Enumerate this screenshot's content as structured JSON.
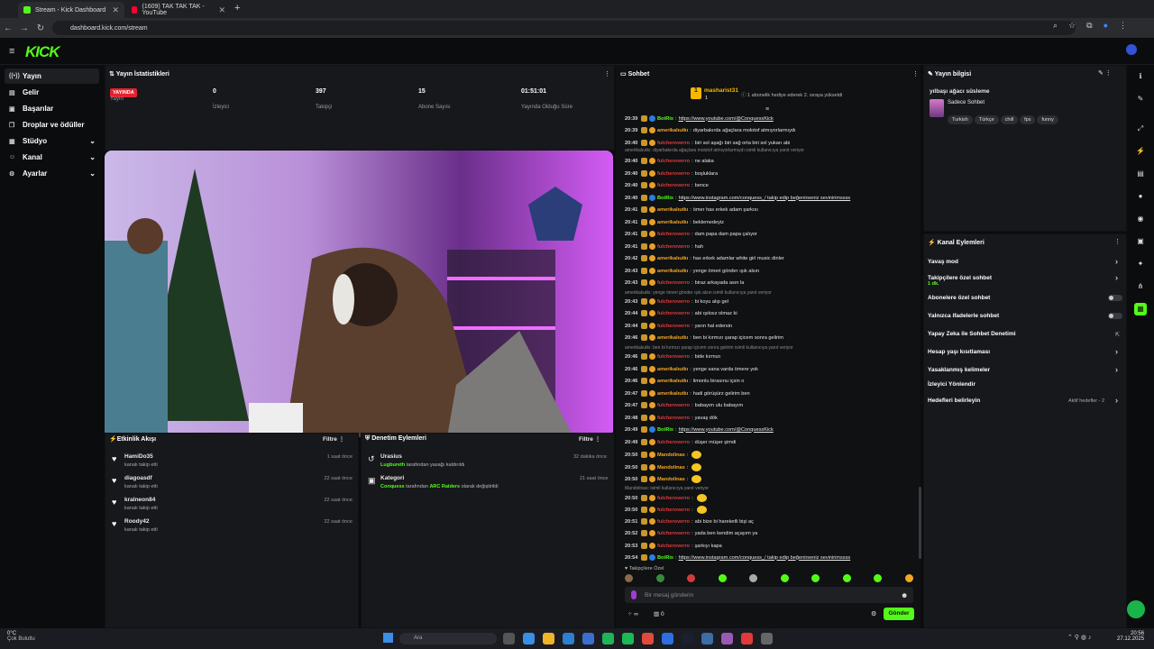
{
  "browser": {
    "tabs": [
      {
        "label": "Stream - Kick Dashboard"
      },
      {
        "label": "(1609) TAK TAK TAK - YouTube"
      }
    ],
    "url": "dashboard.kick.com/stream"
  },
  "nav": {
    "items": [
      {
        "label": "Yayın",
        "icon": "broadcast-icon"
      },
      {
        "label": "Gelir",
        "icon": "revenue-icon"
      },
      {
        "label": "Başarılar",
        "icon": "achievements-icon"
      },
      {
        "label": "Droplar ve ödüller",
        "icon": "drops-icon"
      },
      {
        "label": "Stüdyo",
        "icon": "studio-icon"
      },
      {
        "label": "Kanal",
        "icon": "channel-icon"
      },
      {
        "label": "Ayarlar",
        "icon": "settings-icon"
      }
    ]
  },
  "stats": {
    "title": "Yayın İstatistikleri",
    "live": "YAYINDA",
    "items": [
      {
        "value": "",
        "label": "Yayın"
      },
      {
        "value": "0",
        "label": "İzleyici"
      },
      {
        "value": "397",
        "label": "Takipçi"
      },
      {
        "value": "15",
        "label": "Abone Sayısı"
      },
      {
        "value": "01:51:01",
        "label": "Yayında Olduğu Süre"
      }
    ]
  },
  "activity": {
    "title": "Etkinlik Akışı",
    "filter": "Filtre",
    "items": [
      {
        "name": "HamiDo35",
        "desc": "kanalı takip etti",
        "time": "1 saat önce"
      },
      {
        "name": "diagoasdf",
        "desc": "kanalı takip etti",
        "time": "22 saat önce"
      },
      {
        "name": "kralneon84",
        "desc": "kanalı takip etti",
        "time": "22 saat önce"
      },
      {
        "name": "Roody42",
        "desc": "kanalı takip etti",
        "time": "22 saat önce"
      }
    ]
  },
  "moderation": {
    "title": "Denetim Eylemleri",
    "filter": "Filtre",
    "items": [
      {
        "name": "Urasius",
        "actor": "Lugbureth",
        "desc": "tarafından yasağı kaldırıldı",
        "time": "32 dakika önce"
      },
      {
        "name": "Kategori",
        "actor": "Conquess",
        "mid": "tarafından",
        "target": "ARC Raiders",
        "desc": "olarak değiştirildi",
        "time": "21 saat önce"
      }
    ]
  },
  "chat": {
    "title": "Sohbet",
    "gifter": "masharist31",
    "gifter_count": "1",
    "gift_note": "1 abonelik hediye ederek 2. sıraya yükseldi",
    "messages": [
      {
        "t": "20:39",
        "u": "BotRix",
        "c": "#53fc18",
        "x": "https://www.youtube.com/@ConquessKick"
      },
      {
        "t": "20:39",
        "u": "amerikalıutkı",
        "c": "#f5a623",
        "x": "diyarbakırda ağaçlara molotof atmıyorlarmıydı"
      },
      {
        "t": "20:40",
        "u": "fulcheroverro",
        "c": "#e23b3b",
        "x": "biri sol aşağı biri sağ orta biri sol yukarı abi"
      },
      {
        "t": "20:40",
        "u": "fulcheroverro",
        "c": "#e23b3b",
        "x": "ne alaka"
      },
      {
        "t": "20:40",
        "u": "fulcheroverro",
        "c": "#e23b3b",
        "x": "boşluklara"
      },
      {
        "t": "20:40",
        "u": "fulcheroverro",
        "c": "#e23b3b",
        "x": "bence"
      },
      {
        "t": "20:40",
        "u": "BotRix",
        "c": "#53fc18",
        "x": "https://www.instagram.com/conquess_/ takip edip beğenirseniz sevinirimssss"
      },
      {
        "t": "20:41",
        "u": "amerikalıutkı",
        "c": "#f5a623",
        "x": "ömer has erkek adam şarkısı"
      },
      {
        "t": "20:41",
        "u": "amerikalıutkı",
        "c": "#f5a623",
        "x": "beklemedeyiz"
      },
      {
        "t": "20:41",
        "u": "fulcheroverro",
        "c": "#e23b3b",
        "x": "dam papa dam papa çalıyor"
      },
      {
        "t": "20:41",
        "u": "fulcheroverro",
        "c": "#e23b3b",
        "x": "hah"
      },
      {
        "t": "20:42",
        "u": "amerikalıutkı",
        "c": "#f5a623",
        "x": "has erkek adamlar white girl music dinler"
      },
      {
        "t": "20:43",
        "u": "amerikalıutkı",
        "c": "#f5a623",
        "x": "yenge ömeri gönder ışık alsın"
      },
      {
        "t": "20:43",
        "u": "fulcheroverro",
        "c": "#e23b3b",
        "x": "biraz arkayada asın la"
      },
      {
        "t": "20:43",
        "u": "fulcheroverro",
        "c": "#e23b3b",
        "x": "bi koyu alıp gel"
      },
      {
        "t": "20:44",
        "u": "fulcheroverro",
        "c": "#e23b3b",
        "x": "abi ışıksız olmaz ki"
      },
      {
        "t": "20:44",
        "u": "fulcheroverro",
        "c": "#e23b3b",
        "x": "yarın hal edersin"
      },
      {
        "t": "20:46",
        "u": "amerikalıutkı",
        "c": "#f5a623",
        "x": "ben bi kırmızı şarap içicem sonra gelirim"
      },
      {
        "t": "20:46",
        "u": "fulcheroverro",
        "c": "#e23b3b",
        "x": "bide kırmızı"
      },
      {
        "t": "20:46",
        "u": "amerikalıutkı",
        "c": "#f5a623",
        "x": "yenge sana varda ömere yok"
      },
      {
        "t": "20:46",
        "u": "amerikalıutkı",
        "c": "#f5a623",
        "x": "limonlu birasınu içsin o"
      },
      {
        "t": "20:47",
        "u": "amerikalıutkı",
        "c": "#f5a623",
        "x": "hadi görüşürz gelirim ben"
      },
      {
        "t": "20:47",
        "u": "fulcheroverro",
        "c": "#e23b3b",
        "x": "babayım ulu babayım"
      },
      {
        "t": "20:48",
        "u": "fulcheroverro",
        "c": "#e23b3b",
        "x": "yavaş dök"
      },
      {
        "t": "20:49",
        "u": "BotRix",
        "c": "#53fc18",
        "x": "https://www.youtube.com/@ConquessKick"
      },
      {
        "t": "20:49",
        "u": "fulcheroverro",
        "c": "#e23b3b",
        "x": "düşer müşer şimdi"
      },
      {
        "t": "20:50",
        "u": "Mandolinas",
        "c": "#f5a623",
        "x": ""
      },
      {
        "t": "20:50",
        "u": "Mandolinas",
        "c": "#f5a623",
        "x": ""
      },
      {
        "t": "20:50",
        "u": "Mandolinas",
        "c": "#f5a623",
        "x": ""
      },
      {
        "t": "20:50",
        "u": "fulcheroverro",
        "c": "#e23b3b",
        "x": ""
      },
      {
        "t": "20:50",
        "u": "fulcheroverro",
        "c": "#e23b3b",
        "x": ""
      },
      {
        "t": "20:51",
        "u": "fulcheroverro",
        "c": "#e23b3b",
        "x": "abi bize bi hareketli bişi aç"
      },
      {
        "t": "20:52",
        "u": "fulcheroverro",
        "c": "#e23b3b",
        "x": "yada ben kendim açayım ya"
      },
      {
        "t": "20:53",
        "u": "fulcheroverro",
        "c": "#e23b3b",
        "x": "şarkıyı kapa"
      },
      {
        "t": "20:54",
        "u": "BotRix",
        "c": "#53fc18",
        "x": "https://www.instagram.com/conquess_/ takip edip beğenirseniz sevinirimssss"
      }
    ],
    "replies": [
      "amerikalıutkı: diyarbakırda ağaçlara molotof atmıyorlarmıydı isimli kullanıcıya yanıt veriyor",
      "amerikalıutkı: yenge ömeri gönder ışık alsın isimli kullanıcıya yanıt veriyor",
      "amerikalıutkı: ben bi kırmızı şarap içicem sonra gelirim isimli kullanıcıya yanıt veriyor",
      "Mandolinas: isimli kullanıcıya yanıt veriyor"
    ],
    "followers_only": "Takipçilere Özel",
    "placeholder": "Bir mesaj gönderin",
    "send": "Gönder",
    "count_a": "∞",
    "count_b": "0"
  },
  "info": {
    "title": "Yayın bilgisi",
    "stream_title": "yılbaşı ağacı süsleme",
    "category": "Sadece Sohbet",
    "tags": [
      "Turkish",
      "Türkçe",
      "chill",
      "fps",
      "funny"
    ]
  },
  "actions": {
    "title": "Kanal Eylemleri",
    "items": [
      {
        "label": "Yavaş mod"
      },
      {
        "label": "Takipçilere özel sohbet",
        "sub": "1 dk."
      },
      {
        "label": "Abonelere özel sohbet"
      },
      {
        "label": "Yalnızca ifadelerle sohbet"
      },
      {
        "label": "Yapay Zeka ile Sohbet Denetimi"
      },
      {
        "label": "Hesap yaşı kısıtlaması"
      },
      {
        "label": "Yasaklanmış kelimeler"
      },
      {
        "label": "İzleyici Yönlendir"
      },
      {
        "label": "Hedefleri belirleyin",
        "note": "Aktif hedefler - 2"
      }
    ]
  },
  "taskbar": {
    "weather_temp": "0°C",
    "weather_desc": "Çok Bulutlu",
    "search": "Ara",
    "time": "20:56",
    "date": "27.12.2025"
  }
}
